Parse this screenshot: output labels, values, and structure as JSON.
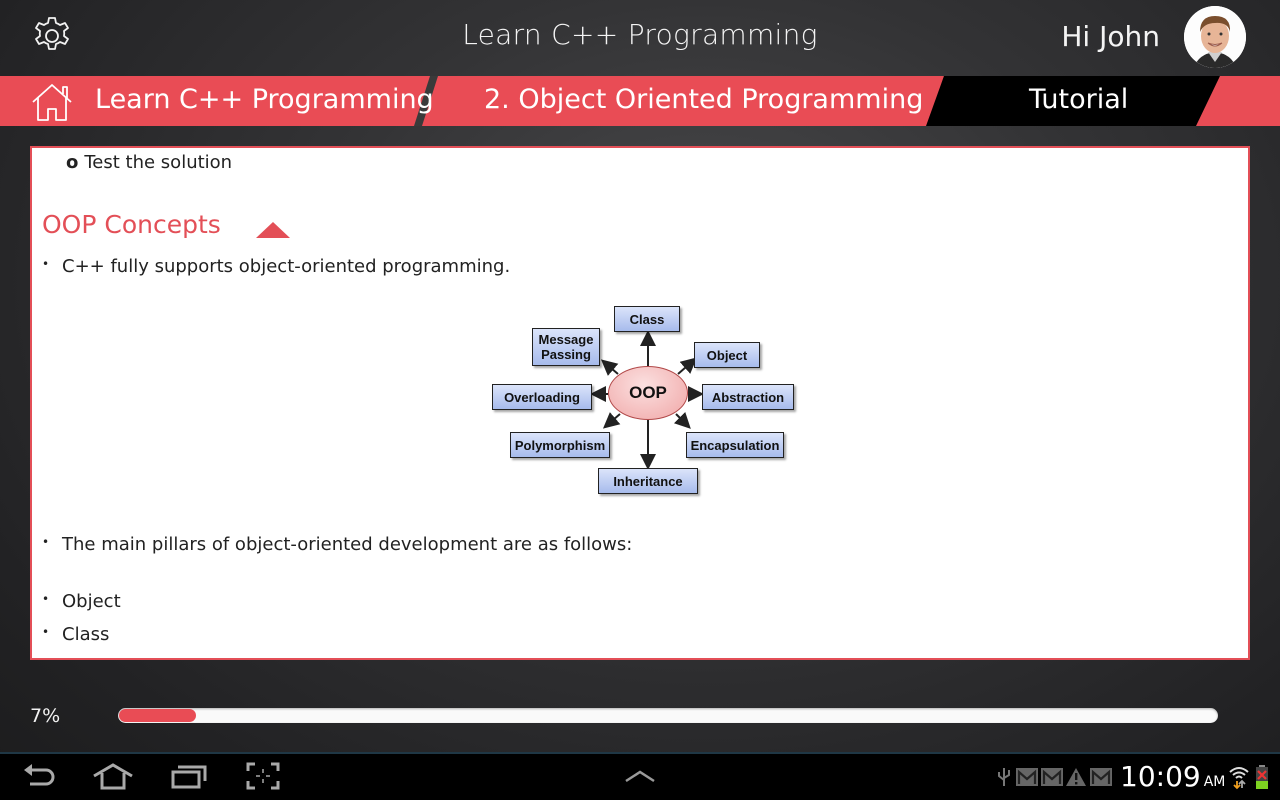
{
  "header": {
    "app_title": "Learn C++ Programming",
    "greeting": "Hi John",
    "settings_icon": "gear-icon",
    "avatar_alt": "John"
  },
  "breadcrumb": {
    "home_icon": "home-icon",
    "items": [
      {
        "label": "Learn C++ Programming"
      },
      {
        "label": "2. Object Oriented Programming"
      },
      {
        "label": "Tutorial"
      }
    ]
  },
  "content": {
    "sub_item_marker": "o",
    "sub_item": "Test the solution",
    "section_title": "OOP Concepts",
    "bullet_marker": "•",
    "bullets_before": [
      "C++ fully supports object-oriented programming."
    ],
    "diagram": {
      "center": "OOP",
      "nodes": [
        "Class",
        "Object",
        "Abstraction",
        "Encapsulation",
        "Inheritance",
        "Polymorphism",
        "Overloading",
        "Message Passing"
      ]
    },
    "intro": "The main pillars of object-oriented development are as follows:",
    "pillars": [
      "Object",
      "Class"
    ]
  },
  "progress": {
    "label": "7%",
    "fraction": 0.07,
    "colors": {
      "fill": "#e94c55",
      "track": "#fafafa"
    }
  },
  "system_bar": {
    "time": "10:09",
    "ampm": "AM",
    "nav_icons": [
      "back-icon",
      "home-icon",
      "recent-apps-icon",
      "screenshot-icon"
    ],
    "status_icons": [
      "usb-icon",
      "gmail-icon",
      "gmail-icon",
      "warning-icon",
      "gmail-icon",
      "wifi-icon",
      "battery-icon"
    ]
  },
  "theme": {
    "accent": "#e94c55",
    "breadcrumb_active_bg": "#000000",
    "text_dark": "#222222"
  }
}
